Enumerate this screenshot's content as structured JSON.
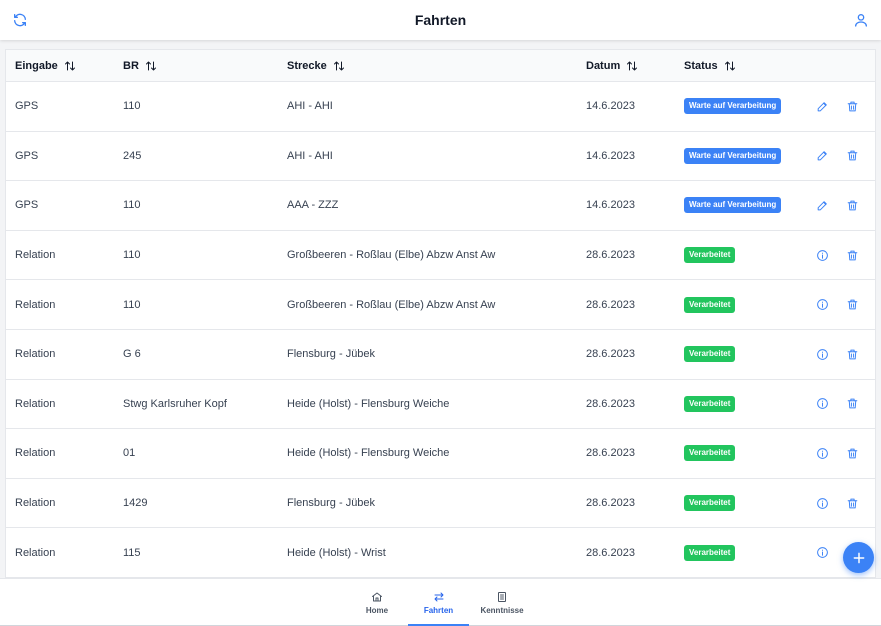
{
  "header": {
    "title": "Fahrten",
    "left_icon": "refresh-icon",
    "right_icon": "user-icon"
  },
  "table": {
    "columns": [
      "Eingabe",
      "BR",
      "Strecke",
      "Datum",
      "Status"
    ],
    "rows": [
      {
        "eingabe": "GPS",
        "br": "110",
        "strecke": "AHI - AHI",
        "datum": "14.6.2023",
        "status": "Warte auf Verarbeitung",
        "status_color": "#3b82f6",
        "action_icon": "pencil-icon"
      },
      {
        "eingabe": "GPS",
        "br": "245",
        "strecke": "AHI - AHI",
        "datum": "14.6.2023",
        "status": "Warte auf Verarbeitung",
        "status_color": "#3b82f6",
        "action_icon": "pencil-icon"
      },
      {
        "eingabe": "GPS",
        "br": "110",
        "strecke": "AAA - ZZZ",
        "datum": "14.6.2023",
        "status": "Warte auf Verarbeitung",
        "status_color": "#3b82f6",
        "action_icon": "pencil-icon"
      },
      {
        "eingabe": "Relation",
        "br": "110",
        "strecke": "Großbeeren - Roßlau (Elbe) Abzw Anst Aw",
        "datum": "28.6.2023",
        "status": "Verarbeitet",
        "status_color": "#22c55e",
        "action_icon": "info-icon"
      },
      {
        "eingabe": "Relation",
        "br": "110",
        "strecke": "Großbeeren - Roßlau (Elbe) Abzw Anst Aw",
        "datum": "28.6.2023",
        "status": "Verarbeitet",
        "status_color": "#22c55e",
        "action_icon": "info-icon"
      },
      {
        "eingabe": "Relation",
        "br": "G 6",
        "strecke": "Flensburg - Jübek",
        "datum": "28.6.2023",
        "status": "Verarbeitet",
        "status_color": "#22c55e",
        "action_icon": "info-icon"
      },
      {
        "eingabe": "Relation",
        "br": "Stwg Karlsruher Kopf",
        "strecke": "Heide (Holst) - Flensburg Weiche",
        "datum": "28.6.2023",
        "status": "Verarbeitet",
        "status_color": "#22c55e",
        "action_icon": "info-icon"
      },
      {
        "eingabe": "Relation",
        "br": "01",
        "strecke": "Heide (Holst) - Flensburg Weiche",
        "datum": "28.6.2023",
        "status": "Verarbeitet",
        "status_color": "#22c55e",
        "action_icon": "info-icon"
      },
      {
        "eingabe": "Relation",
        "br": "1429",
        "strecke": "Flensburg - Jübek",
        "datum": "28.6.2023",
        "status": "Verarbeitet",
        "status_color": "#22c55e",
        "action_icon": "info-icon"
      },
      {
        "eingabe": "Relation",
        "br": "115",
        "strecke": "Heide (Holst) - Wrist",
        "datum": "28.6.2023",
        "status": "Verarbeitet",
        "status_color": "#22c55e",
        "action_icon": "info-icon"
      }
    ]
  },
  "fab": {
    "icon": "plus-icon"
  },
  "bottom_nav": {
    "tabs": [
      {
        "label": "Home",
        "icon": "home-icon",
        "active": false
      },
      {
        "label": "Fahrten",
        "icon": "swap-arrows-icon",
        "active": true
      },
      {
        "label": "Kenntnisse",
        "icon": "document-icon",
        "active": false
      }
    ]
  },
  "colors": {
    "accent": "#3b82f6",
    "waiting": "#3b82f6",
    "processed": "#22c55e",
    "edit_icon": "#3b82f6",
    "delete_icon": "#3b82f6"
  }
}
